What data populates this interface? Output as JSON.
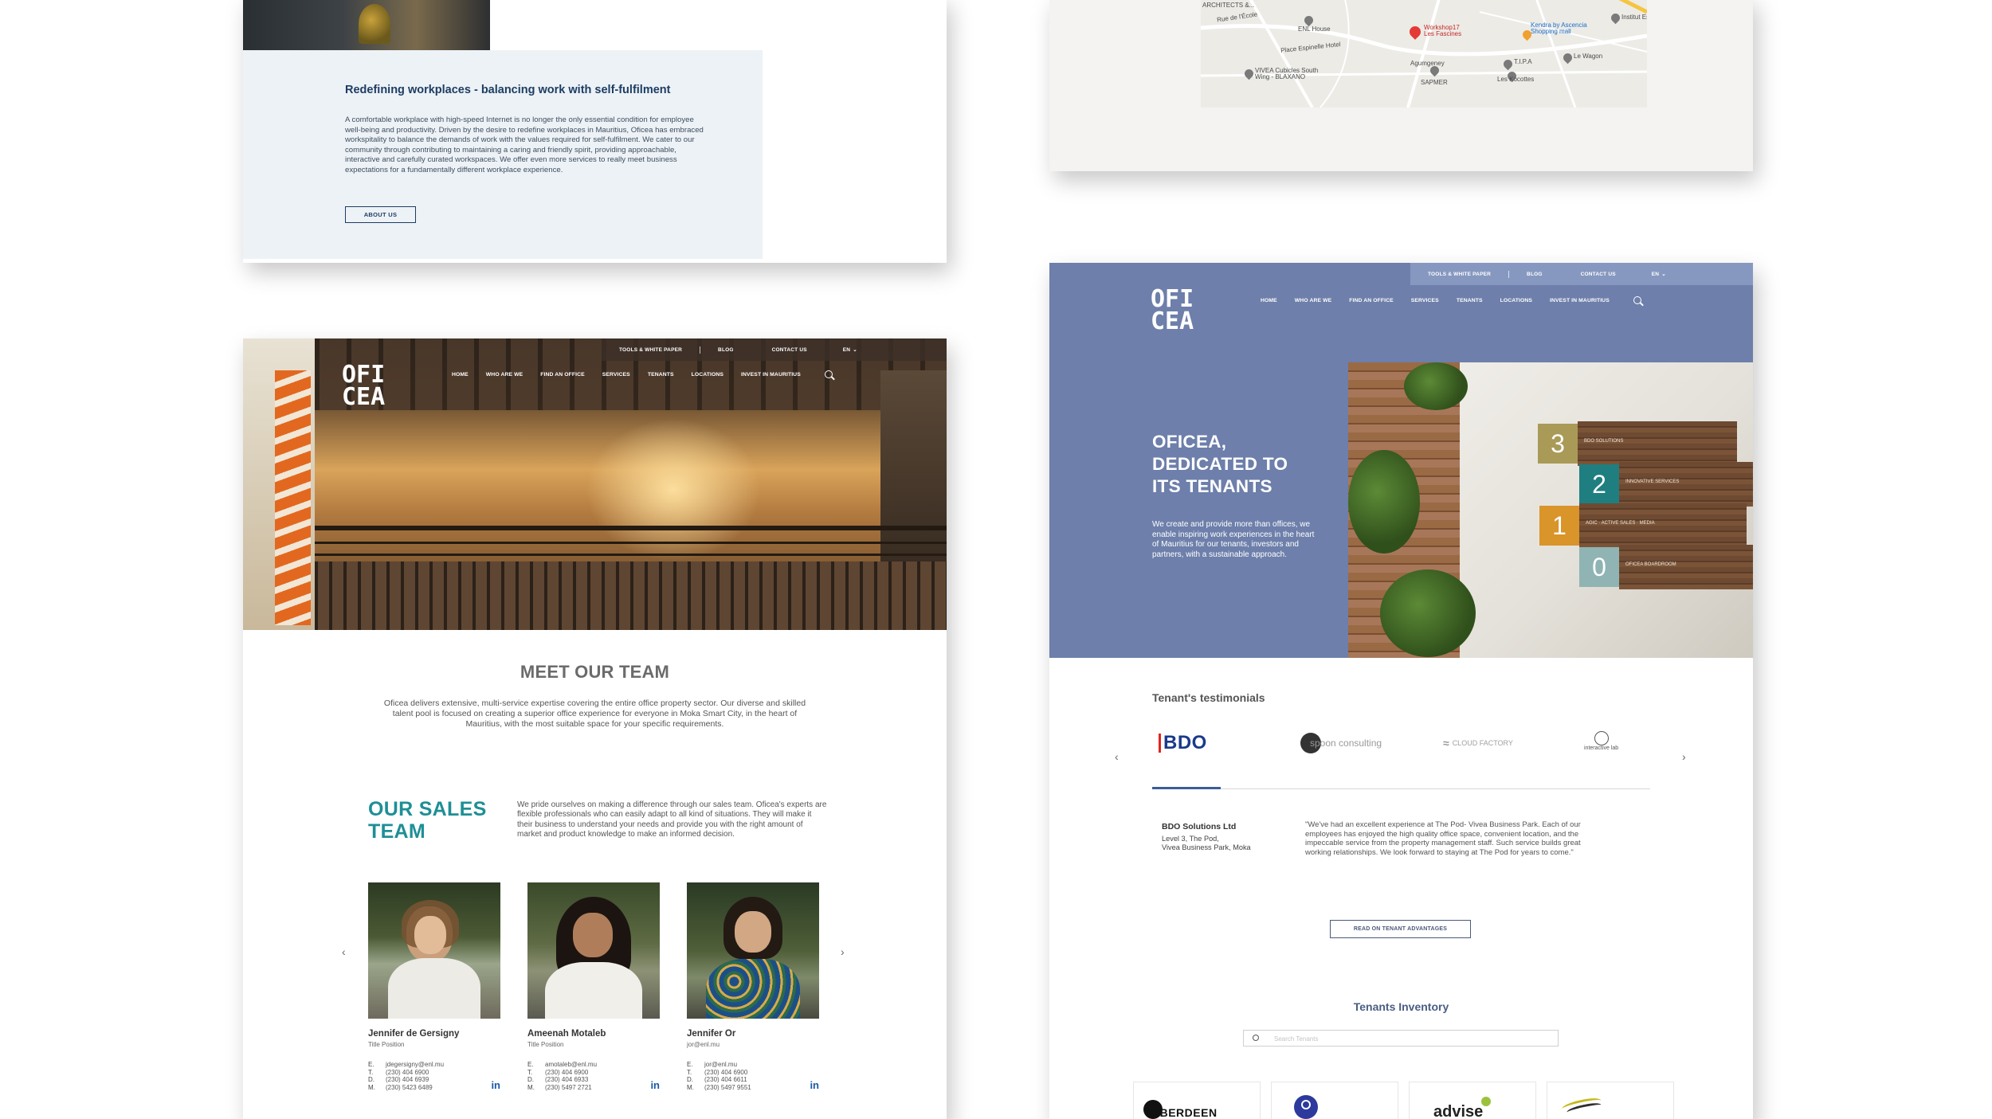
{
  "about_section": {
    "heading": "Redefining workplaces - balancing work with self-fulfilment",
    "body": "A comfortable workplace with high-speed Internet is no longer the only essential condition for employee well-being and productivity. Driven by the desire to redefine workplaces in Mauritius, Oficea has embraced workspitality to balance the demands of work with the values required for self-fulfilment. We cater to our community through contributing to maintaining a caring and friendly spirit, providing approachable, interactive and carefully curated workspaces. We offer even more services to really meet business expectations for a fundamentally different workplace experience.",
    "button_label": "ABOUT US"
  },
  "map": {
    "labels": {
      "architects": "MACBETH\nARCHITECTS &...",
      "enl_house": "ENL House",
      "workshop": "Workshop17\nLes Fascines",
      "kendra": "Kendra by Ascencia\nShopping mall",
      "institut": "Institut Es",
      "vivea_cubicles": "VIVEA Cubicles South\nWing - BLAXANO",
      "agumgeney": "Agumgeney",
      "sapmer": "SAPMER",
      "tipa": "T.I.P.A",
      "le_wagon": "Le Wagon",
      "les_kocottes": "Les Kocottes",
      "rue_de_l_ecole": "Rue de l'École",
      "place_espinelle": "Place Espinelle Hotel"
    }
  },
  "nav": {
    "logo_top": "OFI",
    "logo_bottom": "CEA",
    "util_links": [
      "TOOLS & WHITE PAPER",
      "BLOG",
      "CONTACT US"
    ],
    "lang": "EN",
    "items": [
      "HOME",
      "WHO ARE WE",
      "FIND AN OFFICE",
      "SERVICES",
      "TENANTS",
      "LOCATIONS",
      "INVEST IN MAURITIUS"
    ]
  },
  "team_page": {
    "title": "MEET OUR TEAM",
    "intro": "Oficea delivers extensive, multi-service expertise covering the entire office property sector. Our diverse and skilled talent pool is focused on creating a superior office experience for everyone in Moka Smart City, in the heart of Mauritius, with the most suitable space for your specific requirements.",
    "sales_title_line1": "OUR SALES",
    "sales_title_line2": "TEAM",
    "sales_text": "We pride ourselves on making a difference through our sales team. Oficea's experts are flexible professionals who can easily adapt to all kind of situations. They will make it their business to understand your needs and provide you with the right amount of market and product knowledge to make an informed decision.",
    "members": [
      {
        "name": "Jennifer de Gersigny",
        "role": "Title Position",
        "email": "jdegersigny@enl.mu",
        "t": "(230) 404 6900",
        "d": "(230) 404 6939",
        "m": "(230) 5423 6489"
      },
      {
        "name": "Ameenah Motaleb",
        "role": "Title Position",
        "email": "amotaleb@enl.mu",
        "t": "(230) 404 6900",
        "d": "(230) 404 6933",
        "m": "(230) 5497 2721"
      },
      {
        "name": "Jennifer Or",
        "role": "jor@enl.mu",
        "email": "jor@enl.mu",
        "t": "(230) 404 6900",
        "d": "(230) 404 6611",
        "m": "(230) 5497 9551"
      }
    ],
    "contact_keys": [
      "E.",
      "T.",
      "D.",
      "M."
    ],
    "linkedin_label": "in",
    "arrow_left": "‹",
    "arrow_right": "›"
  },
  "tenants_page": {
    "hero_title_lines": [
      "OFICEA,",
      "DEDICATED TO",
      "ITS TENANTS"
    ],
    "hero_text": "We create and provide more than offices, we enable inspiring work experiences in the heart of Mauritius for our tenants, investors and partners, with a sustainable approach.",
    "floor_signs": [
      {
        "num": "3",
        "label": "BDO SOLUTIONS",
        "color": "#a99a58"
      },
      {
        "num": "2",
        "label": "INNOVATIVE SERVICES",
        "color": "#1f7e80"
      },
      {
        "num": "1",
        "label": "AGIC · ACTIVE SALES · MEDIA",
        "color": "#d9942a"
      },
      {
        "num": "0",
        "label": "OFICEA BOARDROOM",
        "color": "#8fb4b3"
      }
    ],
    "testimonials_title": "Tenant's testimonials",
    "logos": [
      "BDO",
      "spoon consulting",
      "CLOUD FACTORY",
      "interactive lab"
    ],
    "tenant_name": "BDO Solutions Ltd",
    "tenant_address": "Level 3, The Pod,\nVivea Business Park, Moka",
    "quote": "\"We've had an excellent experience at The Pod- Vivea Business Park. Each of our employees has enjoyed the high quality office space, convenient location, and the impeccable service from the property management staff. Such service builds great working relationships. We look forward to staying at The Pod for years to come.\"",
    "read_button": "READ ON TENANT ADVANTAGES",
    "inventory_title": "Tenants Inventory",
    "search_placeholder": "Search Tenants",
    "tenant_cards": [
      "ABERDEEN",
      "",
      "advise",
      ""
    ],
    "arrow_left": "‹",
    "arrow_right": "›"
  },
  "colors": {
    "navy": "#1d3d63",
    "teal": "#1e8f95",
    "slate_blue": "#6d7faa",
    "bdo_red": "#e1251b",
    "bdo_blue": "#1a3a8a"
  }
}
